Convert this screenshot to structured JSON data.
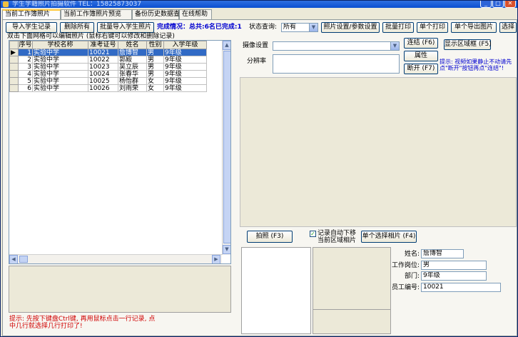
{
  "window": {
    "title": "学生学籍照片拍摄软件 TEL：15825873037",
    "min": "_",
    "max": "□",
    "close": "✕"
  },
  "tabs": [
    "当前工作簿照片",
    "当前工作簿照片预览",
    "备份历史数据查询",
    "在线帮助"
  ],
  "toolbar": {
    "import_students": "导入学生记录",
    "delete_all": "删除所有",
    "batch_import_photos": "批量导入学生照片",
    "status_text": "完成情况：总共:6名已完成:1",
    "status_query_label": "状态查询:",
    "status_query_value": "所有",
    "photo_settings": "照片设置/参数设置",
    "batch_print": "批量打印",
    "single_print": "单个打印",
    "single_export": "单个导出图片",
    "select": "选择"
  },
  "grid": {
    "hint": "双击下面网格可以编辑照片 (鼠标右键可以修改和删除记录)",
    "columns": [
      "序号",
      "学校名称",
      "准考证号",
      "姓名",
      "性别",
      "入学年级"
    ],
    "rows": [
      [
        "1",
        "实验中学",
        "10021",
        "詹博智",
        "男",
        "9年级"
      ],
      [
        "2",
        "实验中学",
        "10022",
        "郭殿",
        "男",
        "9年级"
      ],
      [
        "3",
        "实验中学",
        "10023",
        "吴立辰",
        "男",
        "9年级"
      ],
      [
        "4",
        "实验中学",
        "10024",
        "张春华",
        "男",
        "9年级"
      ],
      [
        "5",
        "实验中学",
        "10025",
        "杨怡群",
        "女",
        "9年级"
      ],
      [
        "6",
        "实验中学",
        "10026",
        "刘雨荣",
        "女",
        "9年级"
      ]
    ]
  },
  "camera": {
    "device_label": "摄像设置",
    "device_value": "",
    "resolution_label": "分辨率",
    "connect_button": "连结 (F6)",
    "show_area_button": "显示区域框 (F5)",
    "properties_button": "属性",
    "disconnect_button": "断开 (F7)",
    "tip": "提示: 视频如果静止不动请先点\"断开\"按钮再点\"连结\"!"
  },
  "capture": {
    "shoot_button": "拍照 (F3)",
    "auto_next_label": "记录自动下移当前区域相片",
    "auto_next_checked": "✓",
    "select_photo_button": "单个选择相片 (F4)"
  },
  "info": {
    "name_label": "姓名:",
    "name_value": "詹博智",
    "post_label": "工作岗位:",
    "post_value": "男",
    "dept_label": "部门:",
    "dept_value": "9年级",
    "id_label": "员工编号:",
    "id_value": "10021"
  },
  "bottom_hint": "提示: 先按下键盘Ctrl键, 再用鼠标点击一行记录, 点中几行就选择几行打印了!"
}
